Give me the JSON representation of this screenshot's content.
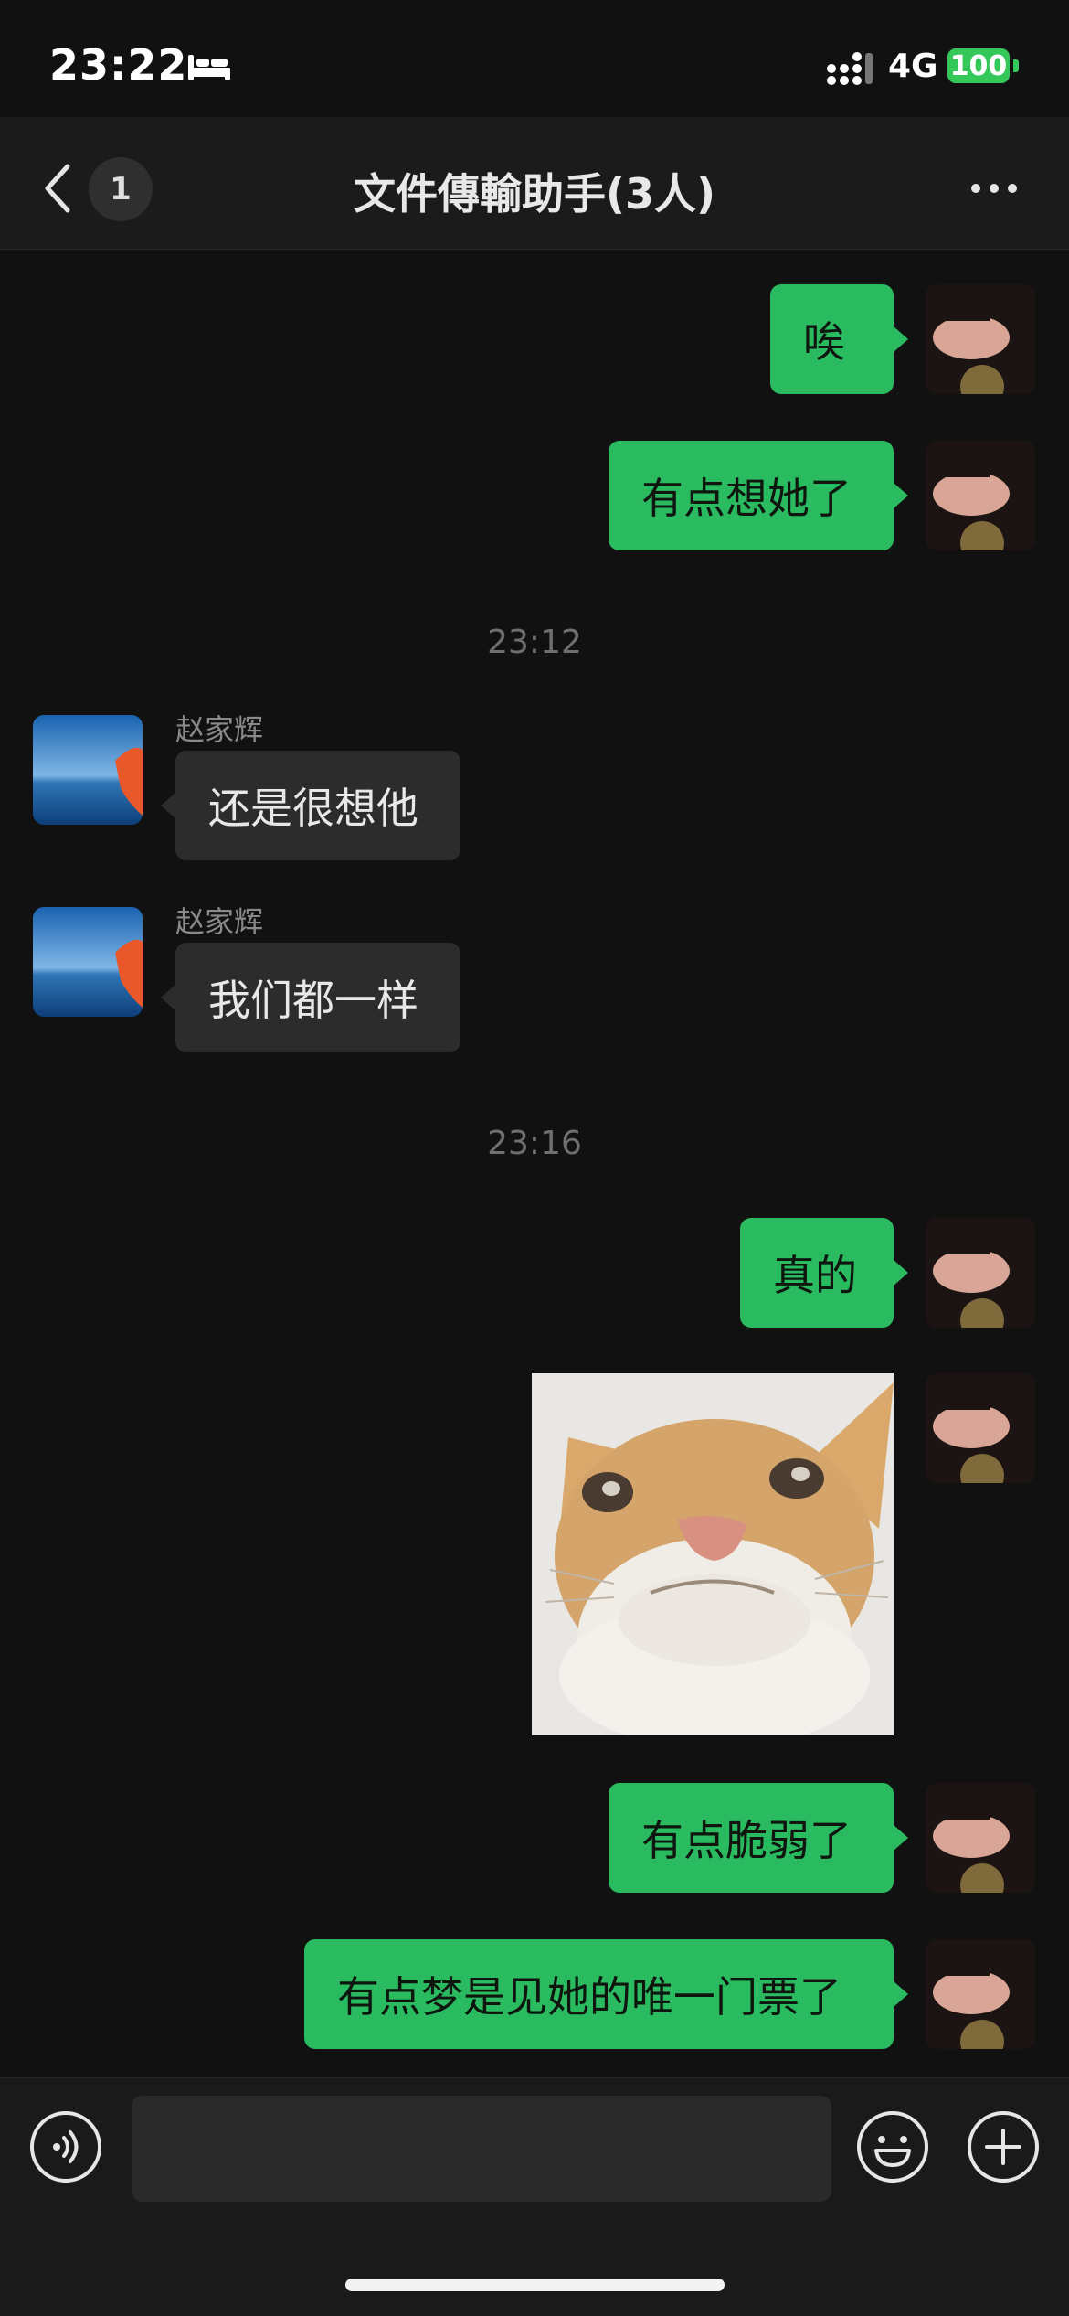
{
  "status_bar": {
    "time": "23:22",
    "mode_icon": "bed-icon",
    "network": "4G",
    "battery": "100",
    "colors": {
      "battery": "#34c759"
    }
  },
  "nav": {
    "back_icon": "chevron-left-icon",
    "unread_count": "1",
    "title": "文件傳輸助手(3人)",
    "more_icon": "more-dots-icon"
  },
  "chat": {
    "colors": {
      "outgoing_bubble": "#2aba5f",
      "incoming_bubble": "#2c2c2c",
      "background": "#111111"
    },
    "messages": [
      {
        "dir": "out",
        "text": "唉"
      },
      {
        "dir": "out",
        "text": "有点想她了"
      },
      {
        "type": "time",
        "text": "23:12"
      },
      {
        "dir": "in",
        "sender": "赵家辉",
        "text": "还是很想他"
      },
      {
        "dir": "in",
        "sender": "赵家辉",
        "text": "我们都一样"
      },
      {
        "type": "time",
        "text": "23:16"
      },
      {
        "dir": "out",
        "text": "真的"
      },
      {
        "dir": "out",
        "type": "sticker",
        "sticker": "cat-sticker"
      },
      {
        "dir": "out",
        "text": "有点脆弱了"
      },
      {
        "dir": "out",
        "text": "有点梦是见她的唯一门票了"
      }
    ]
  },
  "input_bar": {
    "voice_icon": "voice-icon",
    "input_value": "",
    "emoji_icon": "emoji-icon",
    "plus_icon": "plus-icon"
  }
}
